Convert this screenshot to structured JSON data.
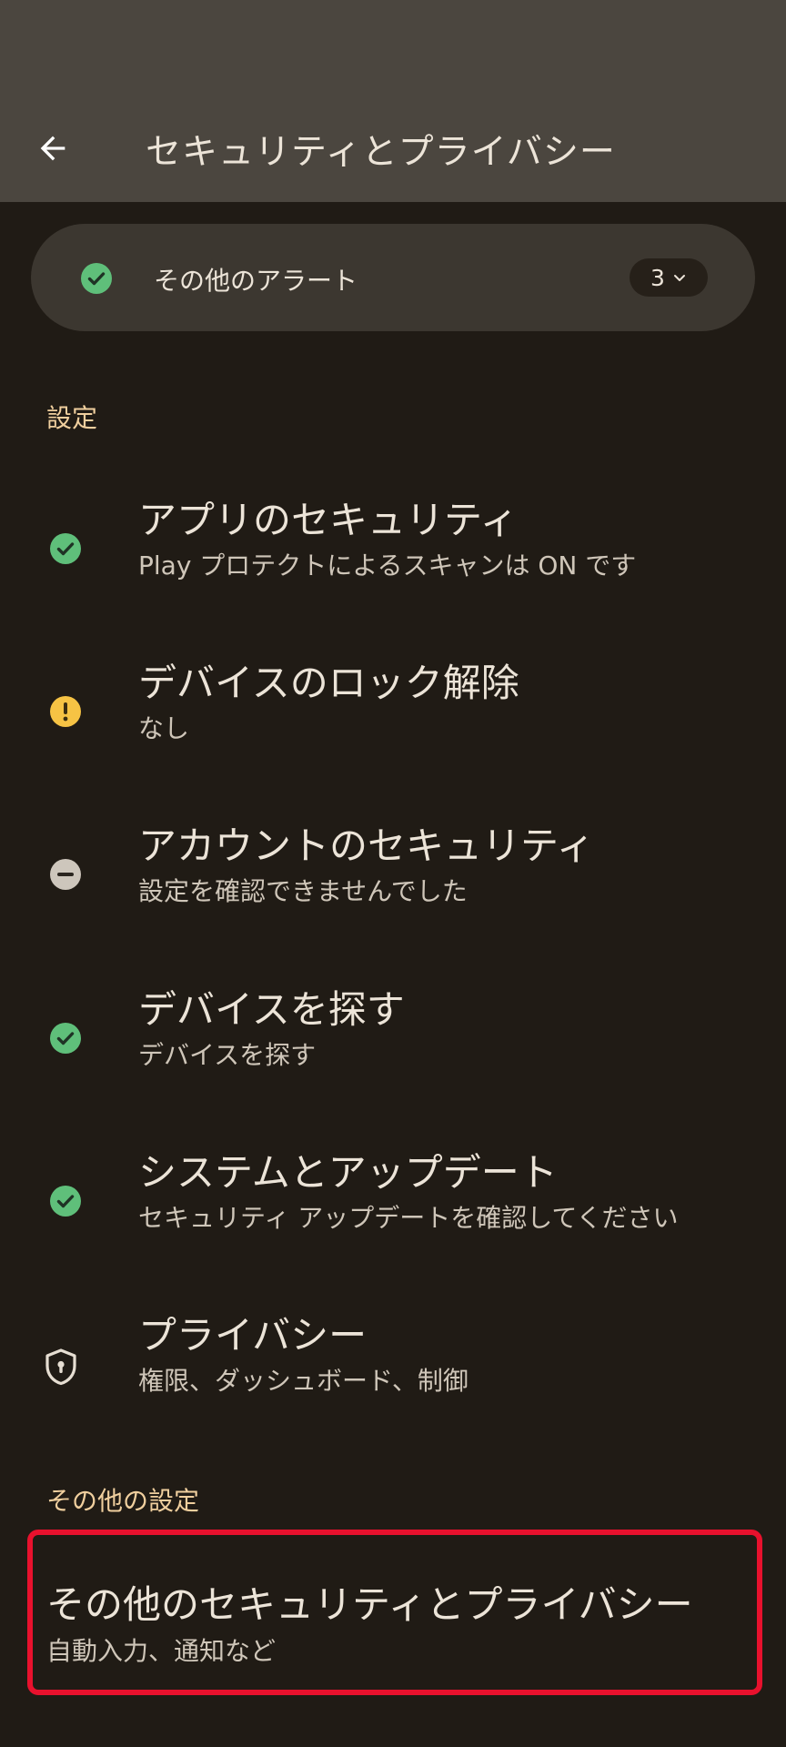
{
  "header": {
    "title": "セキュリティとプライバシー",
    "back_icon": "arrow-back-icon"
  },
  "alerts": {
    "label": "その他のアラート",
    "count": "3",
    "status_icon": "check-circle-icon",
    "expand_icon": "chevron-down-icon"
  },
  "sections": {
    "settings_header": "設定",
    "other_header": "その他の設定"
  },
  "items": [
    {
      "title": "アプリのセキュリティ",
      "subtitle": "Play プロテクトによるスキャンは ON です",
      "icon": "check-circle-icon",
      "status": "ok"
    },
    {
      "title": "デバイスのロック解除",
      "subtitle": "なし",
      "icon": "warning-circle-icon",
      "status": "warning"
    },
    {
      "title": "アカウントのセキュリティ",
      "subtitle": "設定を確認できませんでした",
      "icon": "minus-circle-icon",
      "status": "unknown"
    },
    {
      "title": "デバイスを探す",
      "subtitle": "デバイスを探す",
      "icon": "check-circle-icon",
      "status": "ok"
    },
    {
      "title": "システムとアップデート",
      "subtitle": "セキュリティ アップデートを確認してください",
      "icon": "check-circle-icon",
      "status": "ok"
    },
    {
      "title": "プライバシー",
      "subtitle": "権限、ダッシュボード、制御",
      "icon": "shield-icon",
      "status": "none"
    }
  ],
  "more_settings": {
    "title": "その他のセキュリティとプライバシー",
    "subtitle": "自動入力、通知など"
  },
  "colors": {
    "ok_green": "#5fbf7a",
    "warning_yellow": "#f6c344",
    "unknown_gray": "#cdc6bc",
    "highlight_red": "#e8112d",
    "section_header": "#f0cf9e"
  }
}
